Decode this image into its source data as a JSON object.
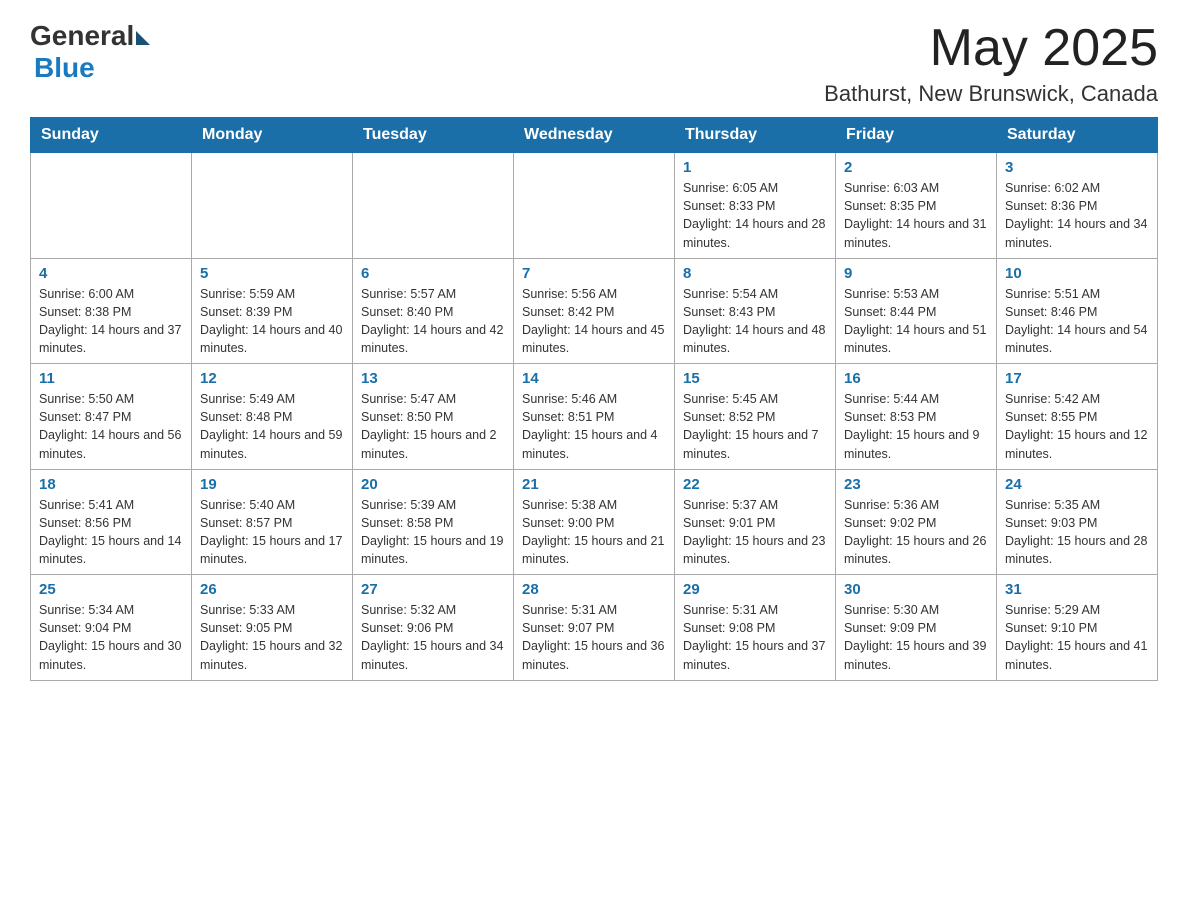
{
  "header": {
    "logo_general": "General",
    "logo_blue": "Blue",
    "month_year": "May 2025",
    "location": "Bathurst, New Brunswick, Canada"
  },
  "weekdays": [
    "Sunday",
    "Monday",
    "Tuesday",
    "Wednesday",
    "Thursday",
    "Friday",
    "Saturday"
  ],
  "weeks": [
    [
      {
        "day": "",
        "info": ""
      },
      {
        "day": "",
        "info": ""
      },
      {
        "day": "",
        "info": ""
      },
      {
        "day": "",
        "info": ""
      },
      {
        "day": "1",
        "info": "Sunrise: 6:05 AM\nSunset: 8:33 PM\nDaylight: 14 hours and 28 minutes."
      },
      {
        "day": "2",
        "info": "Sunrise: 6:03 AM\nSunset: 8:35 PM\nDaylight: 14 hours and 31 minutes."
      },
      {
        "day": "3",
        "info": "Sunrise: 6:02 AM\nSunset: 8:36 PM\nDaylight: 14 hours and 34 minutes."
      }
    ],
    [
      {
        "day": "4",
        "info": "Sunrise: 6:00 AM\nSunset: 8:38 PM\nDaylight: 14 hours and 37 minutes."
      },
      {
        "day": "5",
        "info": "Sunrise: 5:59 AM\nSunset: 8:39 PM\nDaylight: 14 hours and 40 minutes."
      },
      {
        "day": "6",
        "info": "Sunrise: 5:57 AM\nSunset: 8:40 PM\nDaylight: 14 hours and 42 minutes."
      },
      {
        "day": "7",
        "info": "Sunrise: 5:56 AM\nSunset: 8:42 PM\nDaylight: 14 hours and 45 minutes."
      },
      {
        "day": "8",
        "info": "Sunrise: 5:54 AM\nSunset: 8:43 PM\nDaylight: 14 hours and 48 minutes."
      },
      {
        "day": "9",
        "info": "Sunrise: 5:53 AM\nSunset: 8:44 PM\nDaylight: 14 hours and 51 minutes."
      },
      {
        "day": "10",
        "info": "Sunrise: 5:51 AM\nSunset: 8:46 PM\nDaylight: 14 hours and 54 minutes."
      }
    ],
    [
      {
        "day": "11",
        "info": "Sunrise: 5:50 AM\nSunset: 8:47 PM\nDaylight: 14 hours and 56 minutes."
      },
      {
        "day": "12",
        "info": "Sunrise: 5:49 AM\nSunset: 8:48 PM\nDaylight: 14 hours and 59 minutes."
      },
      {
        "day": "13",
        "info": "Sunrise: 5:47 AM\nSunset: 8:50 PM\nDaylight: 15 hours and 2 minutes."
      },
      {
        "day": "14",
        "info": "Sunrise: 5:46 AM\nSunset: 8:51 PM\nDaylight: 15 hours and 4 minutes."
      },
      {
        "day": "15",
        "info": "Sunrise: 5:45 AM\nSunset: 8:52 PM\nDaylight: 15 hours and 7 minutes."
      },
      {
        "day": "16",
        "info": "Sunrise: 5:44 AM\nSunset: 8:53 PM\nDaylight: 15 hours and 9 minutes."
      },
      {
        "day": "17",
        "info": "Sunrise: 5:42 AM\nSunset: 8:55 PM\nDaylight: 15 hours and 12 minutes."
      }
    ],
    [
      {
        "day": "18",
        "info": "Sunrise: 5:41 AM\nSunset: 8:56 PM\nDaylight: 15 hours and 14 minutes."
      },
      {
        "day": "19",
        "info": "Sunrise: 5:40 AM\nSunset: 8:57 PM\nDaylight: 15 hours and 17 minutes."
      },
      {
        "day": "20",
        "info": "Sunrise: 5:39 AM\nSunset: 8:58 PM\nDaylight: 15 hours and 19 minutes."
      },
      {
        "day": "21",
        "info": "Sunrise: 5:38 AM\nSunset: 9:00 PM\nDaylight: 15 hours and 21 minutes."
      },
      {
        "day": "22",
        "info": "Sunrise: 5:37 AM\nSunset: 9:01 PM\nDaylight: 15 hours and 23 minutes."
      },
      {
        "day": "23",
        "info": "Sunrise: 5:36 AM\nSunset: 9:02 PM\nDaylight: 15 hours and 26 minutes."
      },
      {
        "day": "24",
        "info": "Sunrise: 5:35 AM\nSunset: 9:03 PM\nDaylight: 15 hours and 28 minutes."
      }
    ],
    [
      {
        "day": "25",
        "info": "Sunrise: 5:34 AM\nSunset: 9:04 PM\nDaylight: 15 hours and 30 minutes."
      },
      {
        "day": "26",
        "info": "Sunrise: 5:33 AM\nSunset: 9:05 PM\nDaylight: 15 hours and 32 minutes."
      },
      {
        "day": "27",
        "info": "Sunrise: 5:32 AM\nSunset: 9:06 PM\nDaylight: 15 hours and 34 minutes."
      },
      {
        "day": "28",
        "info": "Sunrise: 5:31 AM\nSunset: 9:07 PM\nDaylight: 15 hours and 36 minutes."
      },
      {
        "day": "29",
        "info": "Sunrise: 5:31 AM\nSunset: 9:08 PM\nDaylight: 15 hours and 37 minutes."
      },
      {
        "day": "30",
        "info": "Sunrise: 5:30 AM\nSunset: 9:09 PM\nDaylight: 15 hours and 39 minutes."
      },
      {
        "day": "31",
        "info": "Sunrise: 5:29 AM\nSunset: 9:10 PM\nDaylight: 15 hours and 41 minutes."
      }
    ]
  ]
}
